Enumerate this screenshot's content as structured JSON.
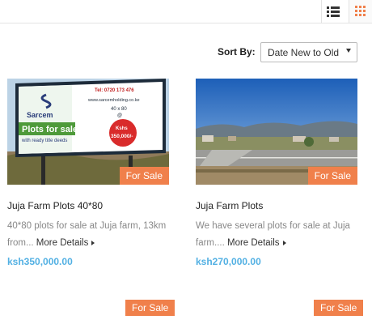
{
  "toolbar": {
    "list_icon": "list-view-icon",
    "grid_icon": "grid-view-icon",
    "accent": "#f0804b"
  },
  "sort": {
    "label": "Sort By:",
    "selected": "Date New to Old"
  },
  "listings": [
    {
      "image_text": {
        "brand": "Sarcem",
        "phone": "Tel: 0720 173 476",
        "website": "www.sarcemholding.co.ke",
        "size": "40 x 80",
        "at": "@",
        "price_line1": "Kshs",
        "price_line2": "350,000/-",
        "headline1": "Plots for sale",
        "headline2": "with ready title deeds"
      },
      "badge": "For Sale",
      "title": "Juja Farm Plots 40*80",
      "desc_line1": "40*80 plots for sale at Juja farm, 13km",
      "desc_line2": "from...",
      "more": "More Details",
      "price": "ksh350,000.00"
    },
    {
      "badge": "For Sale",
      "title": "Juja Farm Plots",
      "desc_line1": "We have several plots for sale at Juja",
      "desc_line2": "farm....",
      "more": "More Details",
      "price": "ksh270,000.00"
    }
  ],
  "next_row_badges": [
    "For Sale",
    "For Sale"
  ],
  "colors": {
    "price": "#52b0e3",
    "badge": "#f0804b"
  }
}
